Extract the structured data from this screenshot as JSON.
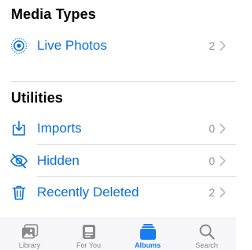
{
  "sections": {
    "media_types": {
      "title": "Media Types",
      "items": [
        {
          "label": "Live Photos",
          "count": "2",
          "icon": "live-photo-icon"
        }
      ]
    },
    "utilities": {
      "title": "Utilities",
      "items": [
        {
          "label": "Imports",
          "count": "0",
          "icon": "import-icon"
        },
        {
          "label": "Hidden",
          "count": "0",
          "icon": "eye-slash-icon"
        },
        {
          "label": "Recently Deleted",
          "count": "2",
          "icon": "trash-icon"
        }
      ]
    }
  },
  "tabbar": {
    "tabs": [
      {
        "label": "Library",
        "icon": "photo-library-icon",
        "active": false
      },
      {
        "label": "For You",
        "icon": "for-you-icon",
        "active": false
      },
      {
        "label": "Albums",
        "icon": "albums-icon",
        "active": true
      },
      {
        "label": "Search",
        "icon": "search-icon",
        "active": false
      }
    ]
  },
  "colors": {
    "accent": "#0a6fd8",
    "tab_active": "#1a7cf2",
    "secondary_text": "#8a8a8e",
    "divider": "#dedee2"
  }
}
